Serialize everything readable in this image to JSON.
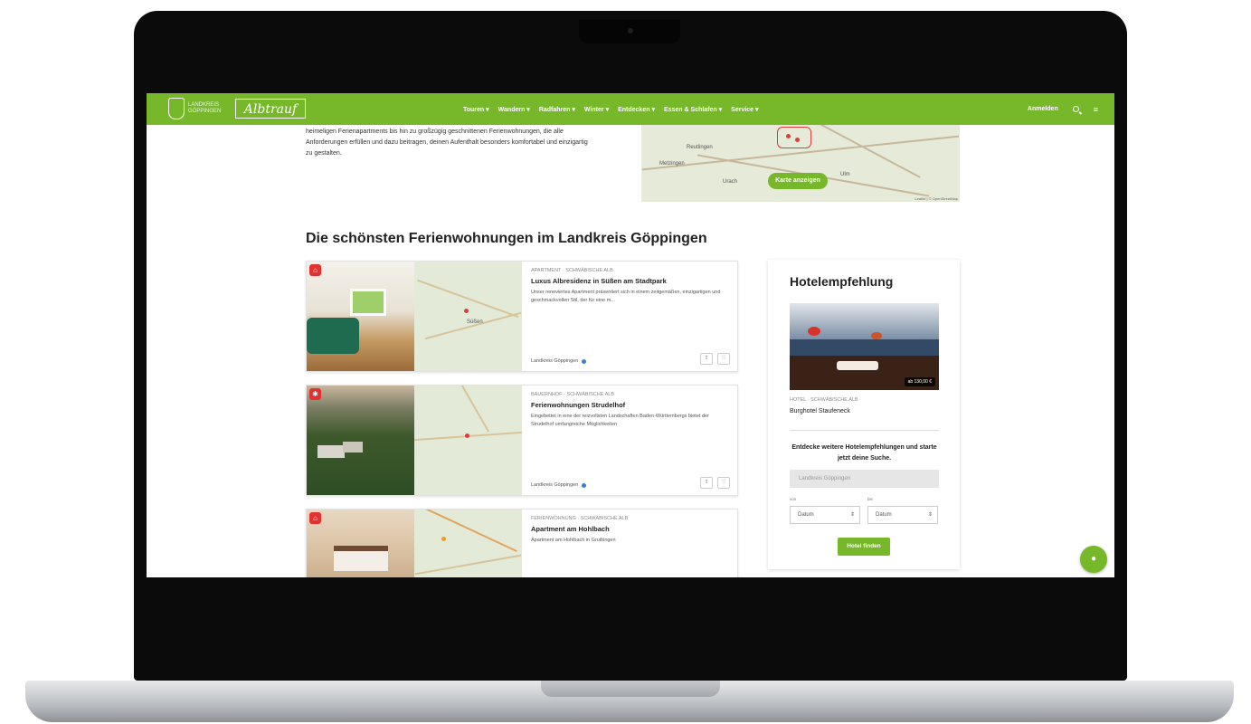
{
  "nav": {
    "logo_text": "LANDKREIS GÖPPINGEN",
    "brand": "Albtrauf",
    "items": [
      "Touren ▾",
      "Wandern ▾",
      "Radfahren ▾",
      "Winter ▾",
      "Entdecken ▾",
      "Essen & Schlafen ▾",
      "Service ▾"
    ],
    "login": "Anmelden",
    "search_icon": "search-icon",
    "menu_icon": "menu-icon"
  },
  "intro": {
    "text": "heimeligen Ferienapartments bis hin zu großzügig geschnittenen Ferienwohnungen, die alle Anforderungen erfüllen und dazu beitragen, deinen Aufenthalt besonders komfortabel und einzigartig zu gestalten."
  },
  "map": {
    "towns": [
      "Reutlingen",
      "Metzingen",
      "Ulm",
      "Urach"
    ],
    "button": "Karte anzeigen",
    "attribution": "Leaflet | © OpenStreetMap"
  },
  "section": {
    "title": "Die schönsten Ferienwohnungen im Landkreis Göppingen"
  },
  "listings": [
    {
      "category": "APARTMENT · SCHWÄBISCHE ALB",
      "title": "Luxus Albresidenz in Süßen am Stadtpark",
      "description": "Unser renoviertes Apartment präsentiert sich in einem zeitgemäßen, einzigartigen und geschmackvollen Stil, der für eine m...",
      "location": "Landkreis Göppingen",
      "map_labels": [
        "Süßen"
      ],
      "badge_icon": "home-icon"
    },
    {
      "category": "BAUERNHOF · SCHWÄBISCHE ALB",
      "title": "Ferienwohnungen Strudelhof",
      "description": "Eingebettet in eine der reizvollsten Landschaften Baden-Württembergs bietet der Strudelhof umfangreiche Möglichkeiten",
      "location": "Landkreis Göppingen",
      "map_labels": [],
      "badge_icon": "farm-icon"
    },
    {
      "category": "FERIENWOHNUNG · SCHWÄBISCHE ALB",
      "title": "Apartment am Hohlbach",
      "description": "Apartment am Hohlbach in Gruibingen",
      "location": "",
      "map_labels": [],
      "badge_icon": "home-icon"
    }
  ],
  "hotel": {
    "title": "Hotelempfehlung",
    "price": "ab 130,00 €",
    "category": "HOTEL · SCHWÄBISCHE ALB",
    "name": "Burghotel Staufeneck",
    "cta": "Entdecke weitere Hotelempfehlungen und starte jetzt deine Suche.",
    "search_placeholder": "Landkreis Göppingen",
    "from_label": "von",
    "to_label": "bis",
    "from_value": "Datum",
    "to_value": "Datum",
    "button": "Hotel finden"
  },
  "colors": {
    "accent": "#76b82a",
    "badge": "#e4302f"
  }
}
